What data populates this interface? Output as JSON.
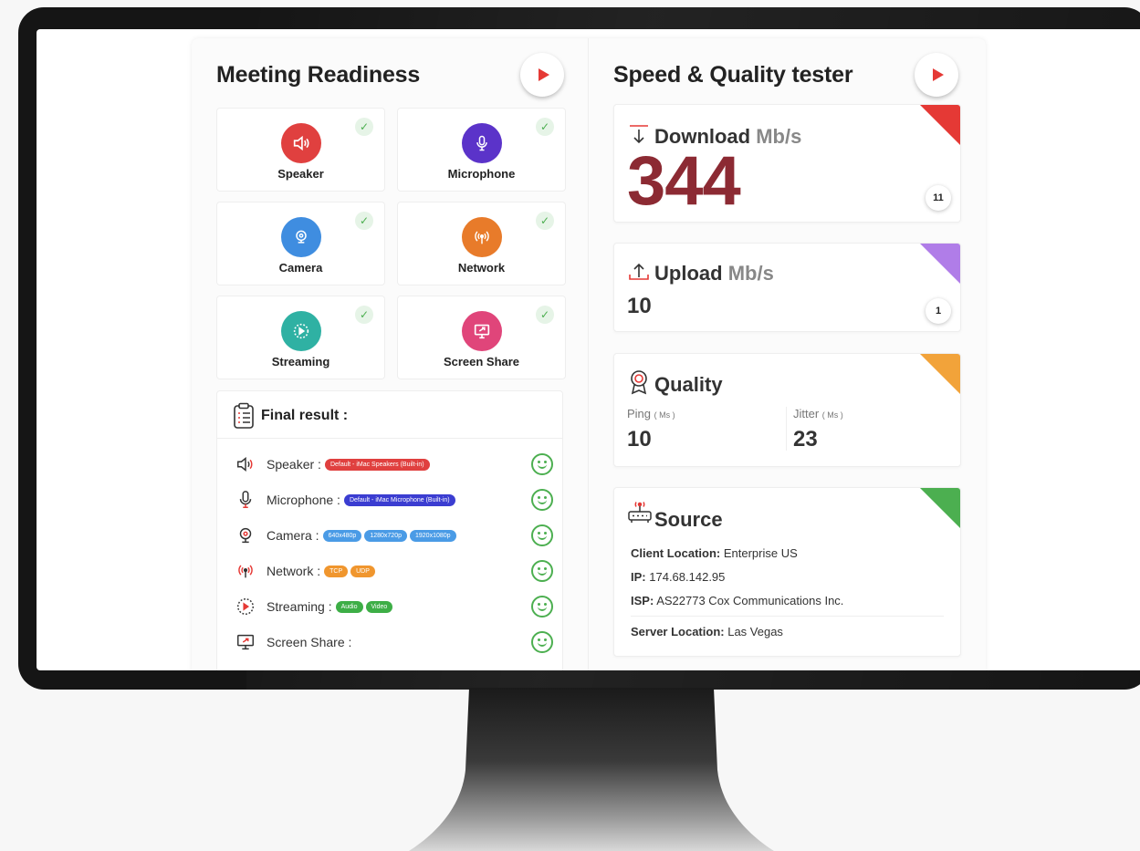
{
  "meeting": {
    "title": "Meeting Readiness",
    "devices": [
      {
        "label": "Speaker",
        "icon": "speaker-icon",
        "color": "#e0403f"
      },
      {
        "label": "Microphone",
        "icon": "microphone-icon",
        "color": "#5b33c9"
      },
      {
        "label": "Camera",
        "icon": "webcam-icon",
        "color": "#3f8de0"
      },
      {
        "label": "Network",
        "icon": "antenna-icon",
        "color": "#e87b2a"
      },
      {
        "label": "Streaming",
        "icon": "streaming-icon",
        "color": "#2fb1a3"
      },
      {
        "label": "Screen Share",
        "icon": "screen-share-icon",
        "color": "#e0457a"
      }
    ],
    "check_mark": "✓"
  },
  "final_result": {
    "title": "Final result :",
    "rows": [
      {
        "label": "Speaker :",
        "badges": [
          {
            "text": "Default - iMac Speakers (Built-in)",
            "color": "#e0403f"
          }
        ]
      },
      {
        "label": "Microphone :",
        "badges": [
          {
            "text": "Default - iMac Microphone (Built-in)",
            "color": "#3b3dd1"
          }
        ]
      },
      {
        "label": "Camera :",
        "badges": [
          {
            "text": "640x480p",
            "color": "#4a9be6"
          },
          {
            "text": "1280x720p",
            "color": "#4a9be6"
          },
          {
            "text": "1920x1080p",
            "color": "#4a9be6"
          }
        ]
      },
      {
        "label": "Network :",
        "badges": [
          {
            "text": "TCP",
            "color": "#f0962e"
          },
          {
            "text": "UDP",
            "color": "#f0962e"
          }
        ]
      },
      {
        "label": "Streaming :",
        "badges": [
          {
            "text": "Audio",
            "color": "#3dae46"
          },
          {
            "text": "Video",
            "color": "#3dae46"
          }
        ]
      },
      {
        "label": "Screen Share :",
        "badges": []
      }
    ]
  },
  "speed": {
    "title": "Speed & Quality tester",
    "download": {
      "label": "Download",
      "unit": "Mb/s",
      "value": "344",
      "count": "11",
      "corner_color": "#e53935"
    },
    "upload": {
      "label": "Upload",
      "unit": "Mb/s",
      "value": "10",
      "count": "1",
      "corner_color": "#b07de8"
    },
    "quality": {
      "label": "Quality",
      "ping_label": "Ping",
      "ping_unit": "( Ms )",
      "ping_value": "10",
      "jitter_label": "Jitter",
      "jitter_unit": "( Ms )",
      "jitter_value": "23",
      "corner_color": "#f2a33a"
    },
    "source": {
      "label": "Source",
      "client_location_label": "Client Location:",
      "client_location": "Enterprise US",
      "ip_label": "IP:",
      "ip": "174.68.142.95",
      "isp_label": "ISP:",
      "isp": "AS22773 Cox Communications Inc.",
      "server_location_label": "Server Location:",
      "server_location": "Las Vegas",
      "corner_color": "#4caf50"
    }
  }
}
